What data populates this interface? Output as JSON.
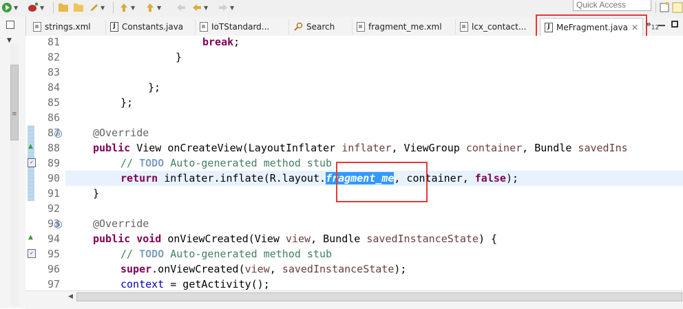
{
  "toolbar": {
    "quick_access_placeholder": "Quick Access"
  },
  "tabs": [
    {
      "label": "strings.xml"
    },
    {
      "label": "Constants.java"
    },
    {
      "label": "IoTStandard..."
    },
    {
      "label": "Search"
    },
    {
      "label": "fragment_me.xml"
    },
    {
      "label": "lcx_contact..."
    },
    {
      "label": "MeFragment.java",
      "active": true
    }
  ],
  "tab_overflow": {
    "symbol": "»",
    "count": "12"
  },
  "line_numbers": [
    "81",
    "82",
    "83",
    "84",
    "85",
    "86",
    "87",
    "88",
    "89",
    "90",
    "91",
    "92",
    "93",
    "94",
    "95",
    "96",
    "97"
  ],
  "code": {
    "l81": "break",
    "l81_tail": ";",
    "l82": "}",
    "l84": "};",
    "l85": "};",
    "l87_annotation": "@Override",
    "l88_kw": "public",
    "l88_a": " View onCreateView(LayoutInflater ",
    "l88_p1": "inflater",
    "l88_b": ", ViewGroup ",
    "l88_p2": "container",
    "l88_c": ", Bundle ",
    "l88_p3": "savedIns",
    "l89_c1": "// ",
    "l89_todo": "TODO",
    "l89_c2": " Auto-generated method stub",
    "l90_kw": "return",
    "l90_a": " inflater.inflate(R.layout.",
    "l90_sel": "fragment_me",
    "l90_b": ", container, ",
    "l90_false": "false",
    "l90_end": ");",
    "l91": "}",
    "l93_annotation": "@Override",
    "l94_kw1": "public",
    "l94_kw2": "void",
    "l94_a": " onViewCreated(View ",
    "l94_p1": "view",
    "l94_b": ", Bundle ",
    "l94_p2": "savedInstanceState",
    "l94_c": ") {",
    "l95_c1": "// ",
    "l95_todo": "TODO",
    "l95_c2": " Auto-generated method stub",
    "l96_kw": "super",
    "l96_a": ".onViewCreated(",
    "l96_p1": "view",
    "l96_b": ", ",
    "l96_p2": "savedInstanceState",
    "l96_c": ");",
    "l97_fld": "context",
    "l97_a": " = getActivity();"
  },
  "icons": {
    "file_icon": "file-icon",
    "java_icon": "java-file-icon",
    "search_icon": "search-icon",
    "close_icon": "close-icon"
  },
  "colors": {
    "keyword": "#7f0055",
    "comment": "#3f7f5f",
    "selection": "#3399ff",
    "highlight_box": "#e53935"
  }
}
